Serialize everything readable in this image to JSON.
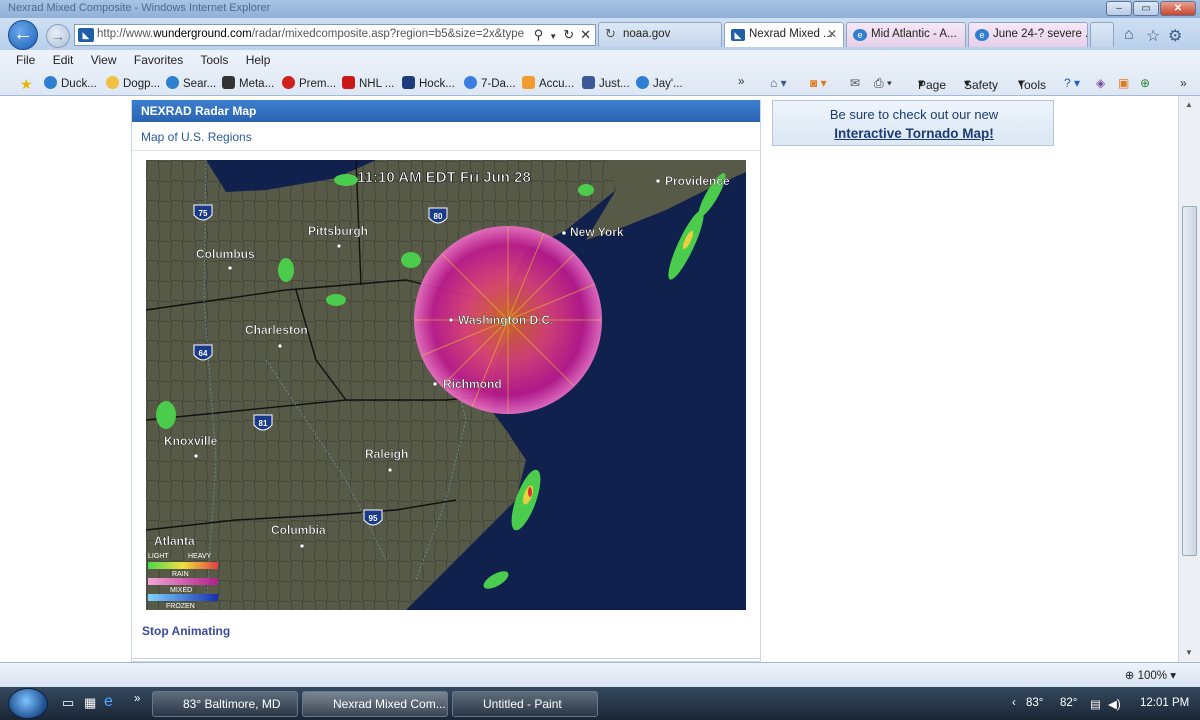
{
  "window": {
    "title": "Nexrad Mixed Composite - Windows Internet Explorer"
  },
  "address": {
    "url_prefix": "http://www.",
    "url_domain": "wunderground.com",
    "url_rest": "/radar/mixedcomposite.asp?region=b5&size=2x&type"
  },
  "tabs": [
    {
      "label": "noaa.gov",
      "active": false
    },
    {
      "label": "Nexrad Mixed ...",
      "active": true
    },
    {
      "label": "Mid Atlantic - A...",
      "active": false
    },
    {
      "label": "June 24-? severe ...",
      "active": false
    }
  ],
  "menu": {
    "items": [
      "File",
      "Edit",
      "View",
      "Favorites",
      "Tools",
      "Help"
    ]
  },
  "favorites": {
    "items": [
      "Duck...",
      "Dogp...",
      "Sear...",
      "Meta...",
      "Prem...",
      "NHL ...",
      "Hock...",
      "7-Da...",
      "Accu...",
      "Just...",
      "Jay'..."
    ]
  },
  "commandbar": {
    "page": "Page",
    "safety": "Safety",
    "tools": "Tools"
  },
  "panel": {
    "header": "NEXRAD Radar Map",
    "link": "Map of U.S. Regions",
    "stop": "Stop Animating"
  },
  "map": {
    "timestamp": "11:10 AM EDT Fri Jun 28",
    "cities": [
      "Providence",
      "New York",
      "Pittsburgh",
      "Columbus",
      "Washington D.C.",
      "Charleston",
      "Richmond",
      "Knoxville",
      "Raleigh",
      "Columbia",
      "Atlanta"
    ],
    "interstates": [
      "75",
      "80",
      "64",
      "81",
      "95"
    ],
    "legend": {
      "light": "LIGHT",
      "heavy": "HEAVY",
      "rain": "RAIN",
      "mixed": "MIXED",
      "frozen": "FROZEN"
    }
  },
  "ad": {
    "line1": "Be sure to check out our new",
    "line2": "Interactive Tornado Map!"
  },
  "status": {
    "zoom": "100%"
  },
  "taskbar": {
    "items": [
      {
        "label": "83° Baltimore, MD",
        "active": false
      },
      {
        "label": "Nexrad Mixed Com...",
        "active": true
      },
      {
        "label": "Untitled - Paint",
        "active": false
      }
    ],
    "temp": "83°",
    "temp2": "82°",
    "clock": "12:01 PM"
  }
}
